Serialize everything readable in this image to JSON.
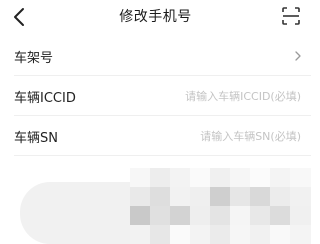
{
  "navbar": {
    "title": "修改手机号",
    "back_icon": "back-chevron-icon",
    "scan_icon": "scan-icon"
  },
  "form": {
    "rows": [
      {
        "label": "车架号",
        "value": "",
        "placeholder": "",
        "trailing": "chevron-right-icon"
      },
      {
        "label": "车辆ICCID",
        "value": "",
        "placeholder": "请输入车辆ICCID(必填)"
      },
      {
        "label": "车辆SN",
        "value": "",
        "placeholder": "请输入车辆SN(必填)"
      }
    ]
  },
  "colors": {
    "background": "#ffffff",
    "text_primary": "#222222",
    "placeholder": "#c4c4c4",
    "divider": "#efefef",
    "blur_gray": "#f1f1f1"
  }
}
